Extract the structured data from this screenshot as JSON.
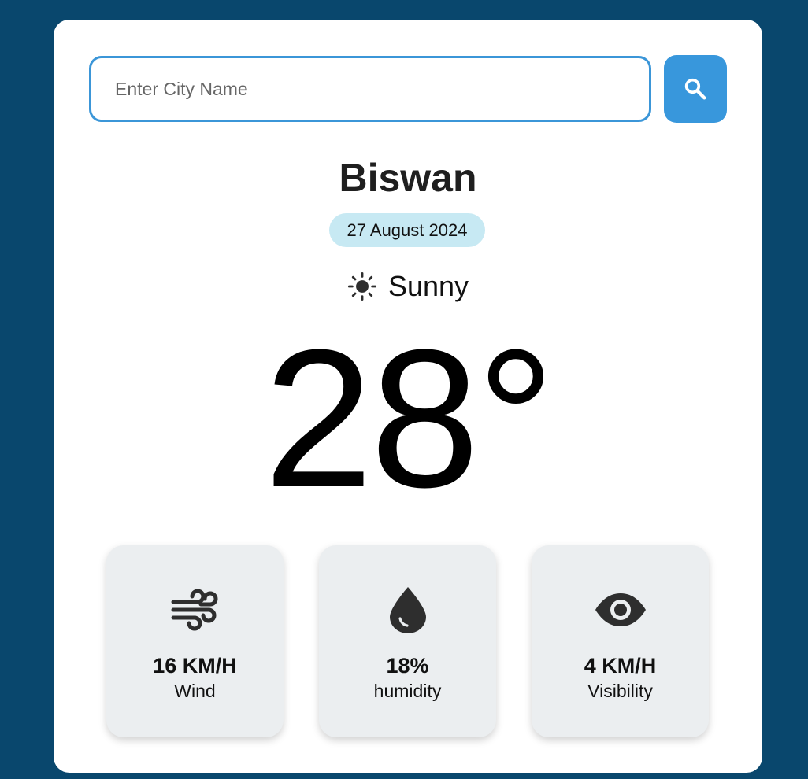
{
  "search": {
    "placeholder": "Enter City Name",
    "value": ""
  },
  "weather": {
    "city": "Biswan",
    "date": "27 August 2024",
    "condition": "Sunny",
    "temperature": "28°"
  },
  "stats": [
    {
      "icon": "wind-icon",
      "value": "16 KM/H",
      "label": "Wind"
    },
    {
      "icon": "humidity-drop-icon",
      "value": "18%",
      "label": "humidity"
    },
    {
      "icon": "eye-icon",
      "value": "4 KM/H",
      "label": "Visibility"
    }
  ],
  "colors": {
    "background": "#09476d",
    "accent": "#3897dc",
    "date_badge": "#c7e9f3",
    "stat_card": "#ebeef0"
  }
}
